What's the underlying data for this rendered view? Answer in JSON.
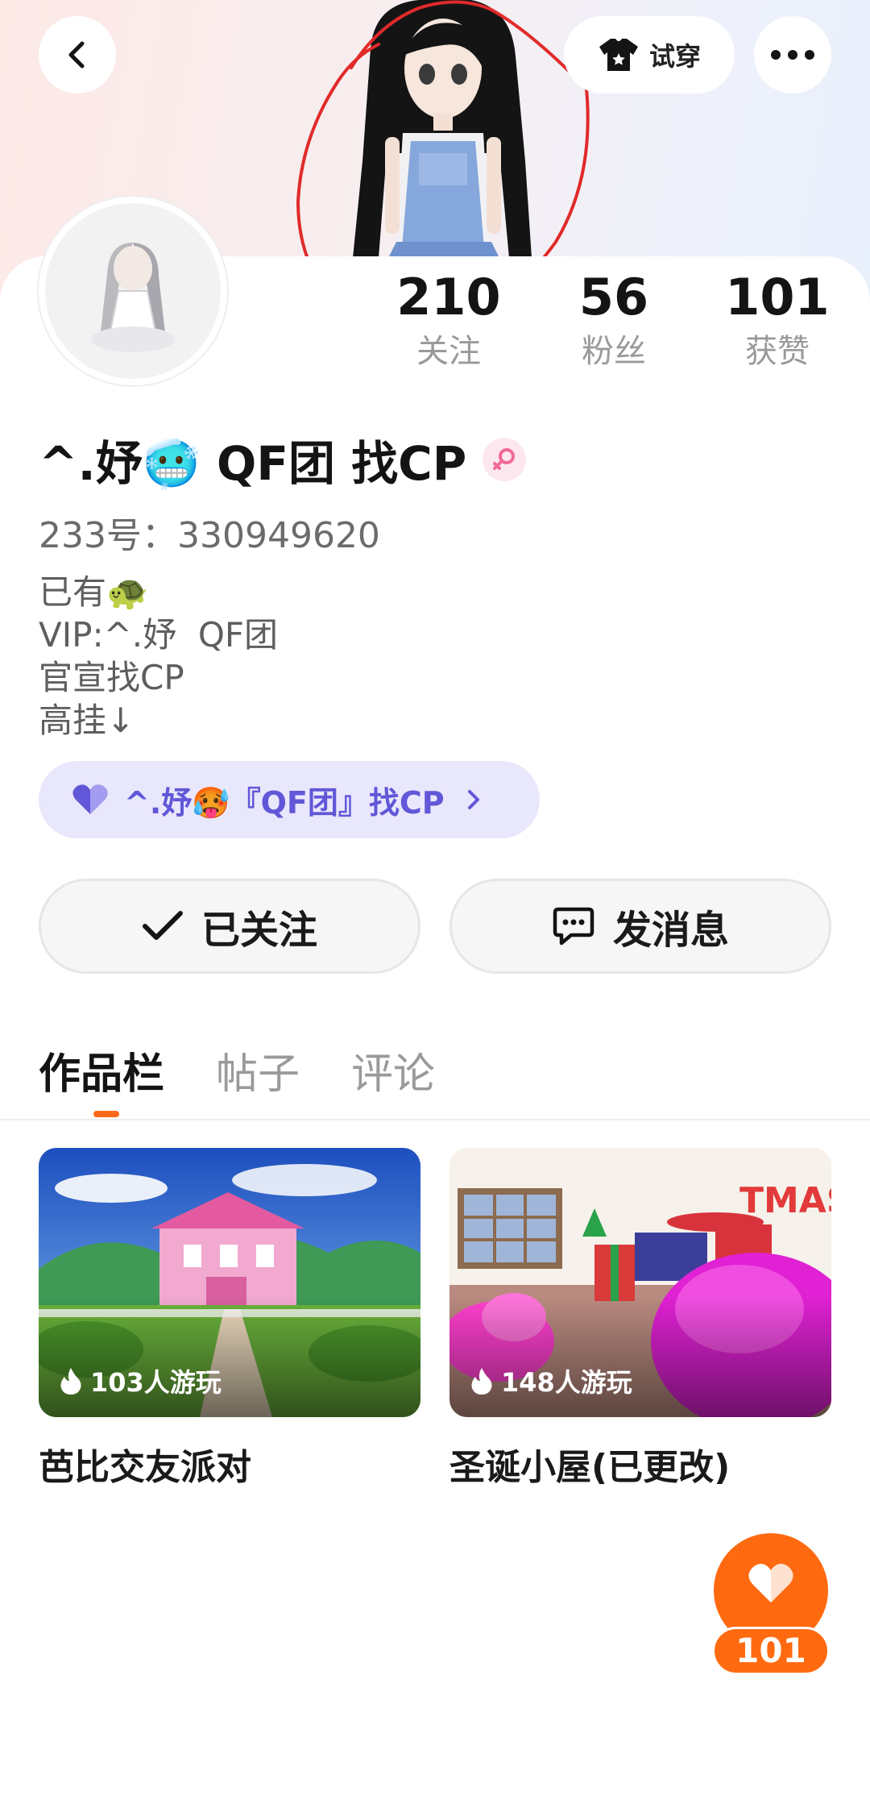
{
  "header": {
    "back_icon": "chevron-left-icon",
    "tryon_label": "试穿",
    "tryon_icon": "tshirt-icon",
    "more_icon": "ellipsis-icon"
  },
  "stats": {
    "following": {
      "value": "210",
      "label": "关注"
    },
    "fans": {
      "value": "56",
      "label": "粉丝"
    },
    "likes": {
      "value": "101",
      "label": "获赞"
    }
  },
  "profile": {
    "username": "^.妤🥶 QF团 找CP",
    "gender_icon": "female-icon",
    "user_id": "233号：330949620",
    "bio_lines": [
      "已有🐢",
      "VIP:^.妤  QF团",
      "官宣找CP",
      "高挂↓"
    ]
  },
  "group_chip": {
    "label": "^.妤🥵『QF团』找CP",
    "icon": "heart-icon",
    "accent": "#6157d8"
  },
  "actions": {
    "follow_label": "已关注",
    "message_label": "发消息"
  },
  "tabs": [
    "作品栏",
    "帖子",
    "评论"
  ],
  "active_tab": "作品栏",
  "works": [
    {
      "title": "芭比交友派对",
      "plays": "103人游玩"
    },
    {
      "title": "圣诞小屋(已更改)",
      "plays": "148人游玩"
    }
  ],
  "like_fab": {
    "count": "101",
    "icon": "heart-icon"
  },
  "colors": {
    "accent_orange": "#ff6a10",
    "chip_bg": "#e9e7fb"
  }
}
